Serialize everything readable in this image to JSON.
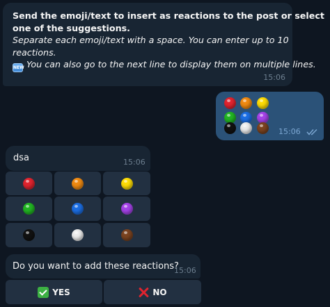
{
  "messages": {
    "instructions": {
      "line1": "Send the emoji/text to insert as reactions to the post or select",
      "line2": "one of the suggestions.",
      "line3": "Separate each emoji/text with a space. You can enter up to 10",
      "line4": "reactions.",
      "line5": "You can also go to the next line to display them on multiple lines.",
      "new_badge": "NEW",
      "time": "15:06"
    },
    "sent": {
      "time": "15:06",
      "status_icon": "double-check-icon",
      "balls": [
        [
          "red",
          "orange",
          "yellow"
        ],
        [
          "green",
          "blue",
          "purple"
        ],
        [
          "black",
          "white",
          "brown"
        ]
      ]
    },
    "dsa": {
      "text": "dsa",
      "time": "15:06"
    },
    "confirm": {
      "text": "Do you want to add these reactions?",
      "time": "15:06"
    }
  },
  "keyboard_emoji": [
    [
      "red",
      "orange",
      "yellow"
    ],
    [
      "green",
      "blue",
      "purple"
    ],
    [
      "black",
      "white",
      "brown"
    ]
  ],
  "keyboard_confirm": {
    "yes_label": "YES",
    "no_label": "NO"
  },
  "colors": {
    "red": "#e0242f",
    "orange": "#f08a12",
    "yellow": "#fddc06",
    "green": "#22b523",
    "blue": "#1c6ee3",
    "purple": "#a543e8",
    "black": "#111111",
    "white": "#ececec",
    "brown": "#7b4320",
    "background": "#0e1621",
    "incoming_bubble": "#182533",
    "outgoing_bubble": "#2b5278"
  }
}
